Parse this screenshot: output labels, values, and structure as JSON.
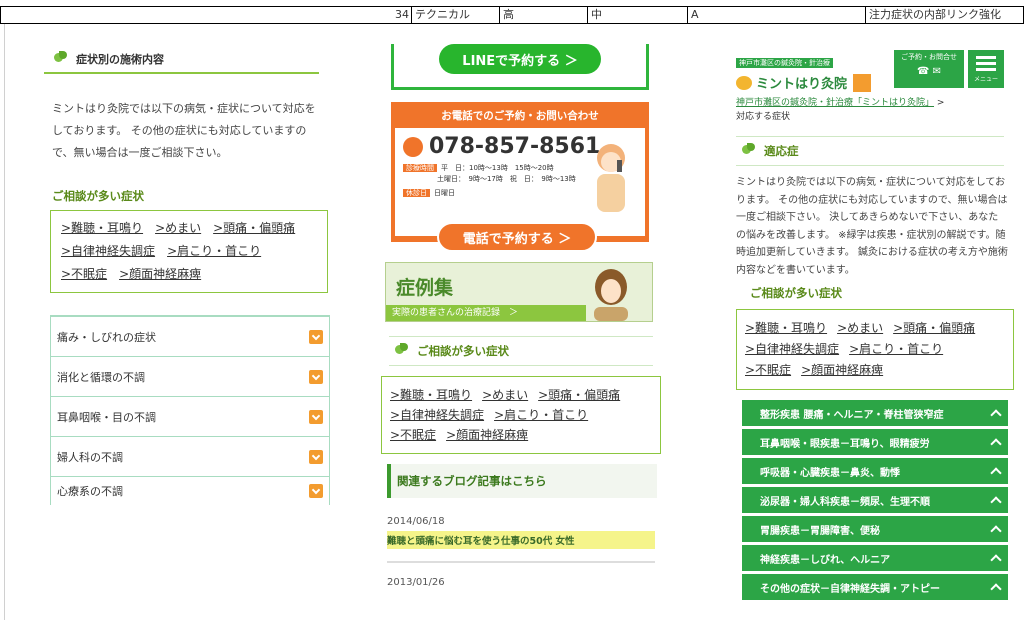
{
  "sheet": {
    "cells": [
      "34",
      "テクニカル",
      "高",
      "中",
      "A",
      "注力症状の内部リンク強化"
    ]
  },
  "col1": {
    "section_title": "症状別の施術内容",
    "intro": "ミントはり灸院では以下の病気・症状について対応をしております。 その他の症状にも対応していますので、無い場合は一度ご相談下さい。",
    "consult_title": "ご相談が多い症状",
    "consult_links": [
      ">難聴・耳鳴り",
      ">めまい",
      ">頭痛・偏頭痛",
      ">自律神経失調症",
      ">肩こり・首こり",
      ">不眠症",
      ">顔面神経麻痺"
    ],
    "categories": [
      "痛み・しびれの症状",
      "消化と循環の不調",
      "耳鼻咽喉・目の不調",
      "婦人科の不調",
      "心療系の不調"
    ]
  },
  "col2": {
    "line_button": "LINEで予約する ＞",
    "tel_header": "お電話でのご予約・お問い合わせ",
    "tel_number": "078-857-8561",
    "hours_label": "診療時間",
    "hours_line1": "平　日：10時〜13時　15時〜20時",
    "hours_line2": "土曜日：　9時〜17時　祝　日：　9時〜13時",
    "holiday_label": "休診日",
    "holiday_value": "日曜日",
    "tel_button": "電話で予約する ＞",
    "case_title": "症例集",
    "case_sub": "実際の患者さんの治療記録　＞",
    "consult_title": "ご相談が多い症状",
    "consult_links": [
      ">難聴・耳鳴り",
      ">めまい",
      ">頭痛・偏頭痛",
      ">自律神経失調症",
      ">肩こり・首こり",
      ">不眠症",
      ">顔面神経麻痺"
    ],
    "blog_title": "関連するブログ記事はこちら",
    "blog_date1": "2014/06/18",
    "blog_link1": "難聴と頭痛に悩む耳を使う仕事の50代 女性",
    "blog_date2": "2013/01/26"
  },
  "col3": {
    "logo_tag": "神戸市灘区の鍼灸院・針治療",
    "logo_name": "ミントはり灸院",
    "contact_label": "ご予約・お問合せ",
    "menu_label": "メニュー",
    "crumb_link": "神戸市灘区の鍼灸院・針治療「ミントはり灸院」",
    "crumb_sep": " >",
    "crumb_current": "対応する症状",
    "section_title": "適応症",
    "intro": "ミントはり灸院では以下の病気・症状について対応をしております。 その他の症状にも対応していますので、無い場合は一度ご相談下さい。 決してあきらめないで下さい、あなたの悩みを改善します。 ※緑字は疾患・症状別の解説です。随時追加更新していきます。 鍼灸における症状の考え方や施術内容などを書いています。",
    "consult_title": "ご相談が多い症状",
    "consult_links": [
      ">難聴・耳鳴り",
      ">めまい",
      ">頭痛・偏頭痛",
      ">自律神経失調症",
      ">肩こり・首こり",
      ">不眠症",
      ">顔面神経麻痺"
    ],
    "categories": [
      "整形疾患 腰痛・ヘルニア・脊柱管狭窄症",
      "耳鼻咽喉・眼疾患－耳鳴り、眼精疲労",
      "呼吸器・心臓疾患－鼻炎、動悸",
      "泌尿器・婦人科疾患－頻尿、生理不順",
      "胃腸疾患－胃腸障害、便秘",
      "神経疾患－しびれ、ヘルニア",
      "その他の症状－自律神経失調・アトピー"
    ]
  },
  "colors": {
    "green": "#2ca546",
    "orange": "#f0742a",
    "light_green": "#8cc63f"
  }
}
